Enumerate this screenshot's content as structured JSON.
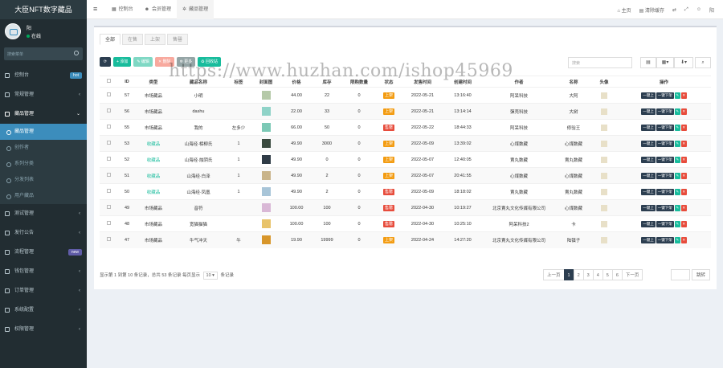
{
  "app": {
    "title": "大臣NFT数字藏品"
  },
  "user": {
    "name": "阳",
    "status": "在线"
  },
  "sidebar": {
    "search_placeholder": "搜索菜单",
    "items": [
      {
        "label": "控制台",
        "badge": "hot",
        "badge_color": "#3c8dbc"
      },
      {
        "label": "常规管理"
      },
      {
        "label": "藏品管理"
      },
      {
        "label": "测试管理"
      },
      {
        "label": "发行公告"
      },
      {
        "label": "流程管理",
        "badge": "new",
        "badge_color": "#605ca8"
      },
      {
        "label": "钱包管理"
      },
      {
        "label": "订单管理"
      },
      {
        "label": "系统配置"
      },
      {
        "label": "权限管理"
      }
    ],
    "submenu": [
      "藏品管理",
      "创作者",
      "系列分类",
      "分发列表",
      "用户藏品"
    ]
  },
  "topbar": {
    "tabs": [
      {
        "label": "控制台",
        "icon": "dashboard-icon"
      },
      {
        "label": "会员管理",
        "icon": "user-icon"
      },
      {
        "label": "藏品管理",
        "icon": "gear-icon"
      }
    ],
    "right": [
      "主页",
      "清除缓存",
      "",
      "",
      "",
      "阳"
    ]
  },
  "tabs": [
    "全部",
    "在售",
    "上架",
    "售罄"
  ],
  "toolbar": {
    "add": "添加",
    "edit": "编辑",
    "del": "删除",
    "more": "更多",
    "recycle": "回收站",
    "search_placeholder": "搜索"
  },
  "table": {
    "headers": [
      "",
      "ID",
      "类型",
      "藏品名称",
      "标签",
      "封面图",
      "价格",
      "库存",
      "限购数量",
      "状态",
      "发售时间",
      "创建时间",
      "作者",
      "名称",
      "头像",
      "操作"
    ],
    "rows": [
      {
        "id": "57",
        "type": "市场藏品",
        "name": "小明",
        "tag": "",
        "price": "44.00",
        "stock": "22",
        "limit": "0",
        "status": "上架",
        "sale": "2022-05-21",
        "created": "13:16:40",
        "author": "阿呆科技",
        "label": "大阿",
        "thumb": "#b5c9a8"
      },
      {
        "id": "56",
        "type": "市场藏品",
        "name": "dashu",
        "tag": "",
        "price": "22.00",
        "stock": "33",
        "limit": "0",
        "status": "上架",
        "sale": "2022-05-21",
        "created": "13:14:14",
        "author": "彈壳科技",
        "label": "大树",
        "thumb": "#8fd3c8"
      },
      {
        "id": "55",
        "type": "市场藏品",
        "name": "我的",
        "tag": "左多少",
        "price": "66.00",
        "stock": "50",
        "limit": "0",
        "status": "售罄",
        "sale": "2022-05-22",
        "created": "18:44:33",
        "author": "阿呆科技",
        "label": "修验王",
        "thumb": "#7cc9b6"
      },
      {
        "id": "53",
        "type": "收藏品",
        "name": "山海经·相柳氏",
        "tag": "1",
        "price": "49.90",
        "stock": "3000",
        "limit": "0",
        "status": "上架",
        "sale": "2022-05-09",
        "created": "13:39:02",
        "author": "心煤数藏",
        "label": "心煤数藏",
        "thumb": "#3a4a3f"
      },
      {
        "id": "52",
        "type": "收藏品",
        "name": "山海经·烛阴氏",
        "tag": "1",
        "price": "49.90",
        "stock": "0",
        "limit": "0",
        "status": "上架",
        "sale": "2022-05-07",
        "created": "12:40:05",
        "author": "賣丸数藏",
        "label": "賣丸数藏",
        "thumb": "#2f3b46"
      },
      {
        "id": "51",
        "type": "收藏品",
        "name": "山海经·白泽",
        "tag": "1",
        "price": "49.90",
        "stock": "2",
        "limit": "0",
        "status": "上架",
        "sale": "2022-05-07",
        "created": "20:41:55",
        "author": "心煤数藏",
        "label": "心煤数藏",
        "thumb": "#c9b48a"
      },
      {
        "id": "50",
        "type": "收藏品",
        "name": "山海经·凤凰",
        "tag": "1",
        "price": "49.90",
        "stock": "2",
        "limit": "0",
        "status": "售罄",
        "sale": "2022-05-09",
        "created": "18:18:02",
        "author": "賣丸数藏",
        "label": "賣丸数藏",
        "thumb": "#a8c5d8"
      },
      {
        "id": "49",
        "type": "市场藏品",
        "name": "音符",
        "tag": "",
        "price": "100.00",
        "stock": "100",
        "limit": "0",
        "status": "售罄",
        "sale": "2022-04-30",
        "created": "10:19:27",
        "author": "北京賣丸文化传媒有限公司",
        "label": "心煤数藏",
        "thumb": "#d9b8d6"
      },
      {
        "id": "48",
        "type": "市场藏品",
        "name": "宽猫猫猫",
        "tag": "",
        "price": "100.00",
        "stock": "100",
        "limit": "0",
        "status": "售罄",
        "sale": "2022-04-30",
        "created": "10:25:10",
        "author": "阿呆科技2",
        "label": "卡",
        "thumb": "#e8c36a"
      },
      {
        "id": "47",
        "type": "市场藏品",
        "name": "牛气冲天",
        "tag": "牛",
        "price": "19.90",
        "stock": "19999",
        "limit": "0",
        "status": "上架",
        "sale": "2022-04-24",
        "created": "14:27:20",
        "author": "北京賣丸文化传媒有限公司",
        "label": "陆镇子",
        "thumb": "#d8962a"
      }
    ],
    "op_labels": [
      "一键上",
      "一键下架"
    ]
  },
  "footer": {
    "info": "显示第 1 到第 10 条记录，总共 53 条记录 每页显示",
    "per_page": "10",
    "info_tail": "条记录",
    "pages": [
      "上一页",
      "1",
      "2",
      "3",
      "4",
      "5",
      "6",
      "下一页"
    ],
    "jump": "跳转"
  },
  "watermark": "https://www.huzhan.com/ishop45969",
  "colors": {
    "sidebar": "#222d32",
    "accent": "#3c8dbc",
    "success": "#18bc9c",
    "danger": "#e74c3c",
    "warning": "#f39c12",
    "dark": "#2c3e50"
  }
}
